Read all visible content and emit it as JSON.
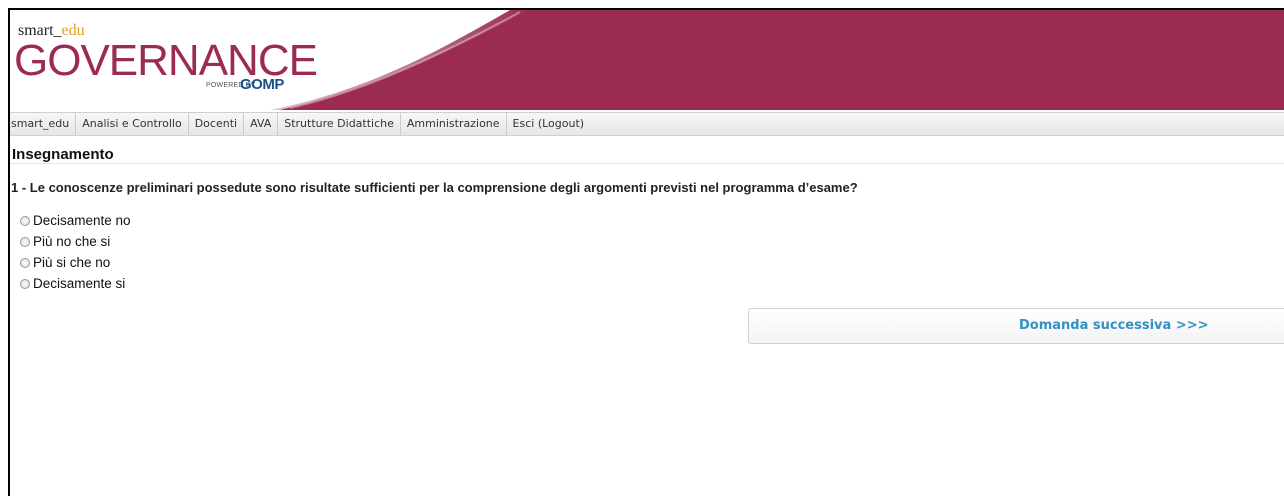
{
  "header": {
    "brand_prefix": "smart",
    "brand_separator": "_",
    "brand_suffix": "edu",
    "title": "GOVERNANCE",
    "powered_by": "POWERED BY",
    "powered_brand": "GOMP",
    "colors": {
      "banner": "#9b2b53",
      "edu_accent": "#e0a020",
      "gomp": "#1b4f8c"
    }
  },
  "menu": {
    "items": [
      {
        "label": "smart_edu"
      },
      {
        "label": "Analisi e Controllo"
      },
      {
        "label": "Docenti"
      },
      {
        "label": "AVA"
      },
      {
        "label": "Strutture Didattiche"
      },
      {
        "label": "Amministrazione"
      },
      {
        "label": "Esci (Logout)"
      }
    ]
  },
  "section": {
    "title": "Insegnamento"
  },
  "question": {
    "text": "1 - Le conoscenze preliminari possedute sono risultate sufficienti per la comprensione degli argomenti previsti nel programma d’esame?",
    "options": [
      {
        "label": "Decisamente no",
        "selected": false
      },
      {
        "label": "Più no che si",
        "selected": false
      },
      {
        "label": "Più si che no",
        "selected": false
      },
      {
        "label": "Decisamente si",
        "selected": false
      }
    ]
  },
  "actions": {
    "next_label": "Domanda successiva >>>",
    "next_color": "#3390c0"
  }
}
